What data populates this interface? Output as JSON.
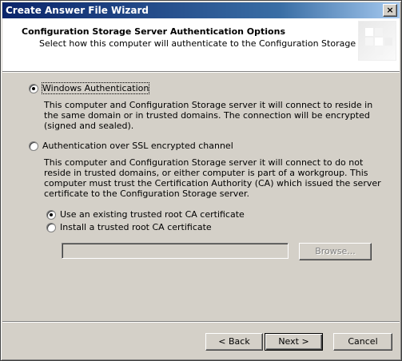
{
  "window": {
    "title": "Create Answer File Wizard",
    "close_glyph": "×"
  },
  "header": {
    "title": "Configuration Storage Server Authentication Options",
    "subtitle": "Select how this computer will authenticate to the Configuration Storage server."
  },
  "options": {
    "windows_auth": {
      "label": "Windows Authentication",
      "selected": true,
      "description": "This computer and Configuration Storage server it will connect to reside in the same domain or in trusted domains. The connection will be encrypted (signed and sealed)."
    },
    "ssl_auth": {
      "label": "Authentication over SSL encrypted channel",
      "selected": false,
      "description": "This computer and Configuration Storage server it will connect to do not reside in trusted domains, or either computer is part of a workgroup. This computer must trust the Certification Authority (CA) which issued the server certificate to the Configuration Storage server."
    }
  },
  "ssl_suboptions": {
    "existing_ca": {
      "label": "Use an existing trusted root CA certificate",
      "selected": true
    },
    "install_ca": {
      "label": "Install a trusted root CA certificate",
      "selected": false
    },
    "certificate_path": "",
    "browse_label": "Browse..."
  },
  "footer": {
    "back_label": "< Back",
    "next_label": "Next >",
    "cancel_label": "Cancel"
  }
}
